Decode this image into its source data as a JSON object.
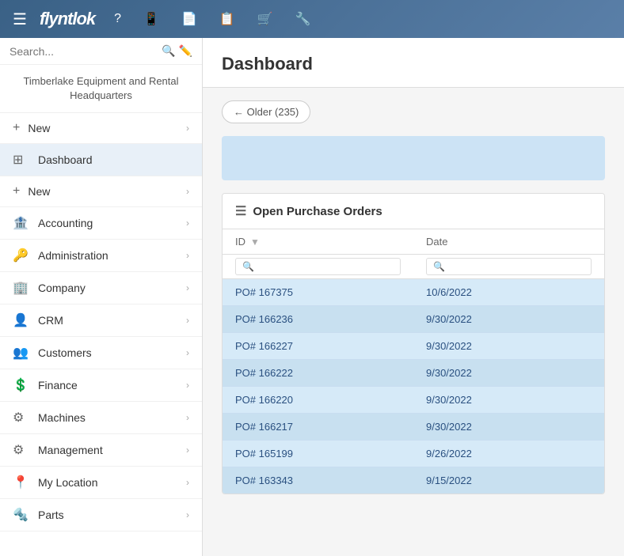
{
  "app": {
    "logo": "flyntlok",
    "title": "Dashboard"
  },
  "topnav": {
    "icons": [
      "☰",
      "?",
      "📱",
      "📄",
      "📋",
      "🛒",
      "🔧"
    ]
  },
  "sidebar": {
    "search_placeholder": "Search...",
    "company_name": "Timberlake Equipment and Rental",
    "company_sub": "Headquarters",
    "items": [
      {
        "id": "new-top",
        "label": "New",
        "icon": "+",
        "has_chevron": true,
        "type": "plus"
      },
      {
        "id": "dashboard",
        "label": "Dashboard",
        "icon": "⊞",
        "has_chevron": false,
        "type": "icon"
      },
      {
        "id": "new-2",
        "label": "New",
        "icon": "+",
        "has_chevron": true,
        "type": "plus"
      },
      {
        "id": "accounting",
        "label": "Accounting",
        "icon": "🏦",
        "has_chevron": true,
        "type": "icon"
      },
      {
        "id": "administration",
        "label": "Administration",
        "icon": "🔑",
        "has_chevron": true,
        "type": "icon"
      },
      {
        "id": "company",
        "label": "Company",
        "icon": "⚙",
        "has_chevron": true,
        "type": "icon"
      },
      {
        "id": "crm",
        "label": "CRM",
        "icon": "👤",
        "has_chevron": true,
        "type": "icon"
      },
      {
        "id": "customers",
        "label": "Customers",
        "icon": "👥",
        "has_chevron": true,
        "type": "icon"
      },
      {
        "id": "finance",
        "label": "Finance",
        "icon": "💲",
        "has_chevron": true,
        "type": "icon"
      },
      {
        "id": "machines",
        "label": "Machines",
        "icon": "⚙",
        "has_chevron": true,
        "type": "icon"
      },
      {
        "id": "management",
        "label": "Management",
        "icon": "⚙",
        "has_chevron": true,
        "type": "icon"
      },
      {
        "id": "my-location",
        "label": "My Location",
        "icon": "⚙",
        "has_chevron": true,
        "type": "icon"
      },
      {
        "id": "parts",
        "label": "Parts",
        "icon": "⚙",
        "has_chevron": true,
        "type": "icon"
      }
    ]
  },
  "content": {
    "title": "Dashboard",
    "older_button": "← Older (235)",
    "table": {
      "title": "Open Purchase Orders",
      "columns": [
        "ID",
        "Date"
      ],
      "rows": [
        {
          "id": "PO# 167375",
          "date": "10/6/2022"
        },
        {
          "id": "PO# 166236",
          "date": "9/30/2022"
        },
        {
          "id": "PO# 166227",
          "date": "9/30/2022"
        },
        {
          "id": "PO# 166222",
          "date": "9/30/2022"
        },
        {
          "id": "PO# 166220",
          "date": "9/30/2022"
        },
        {
          "id": "PO# 166217",
          "date": "9/30/2022"
        },
        {
          "id": "PO# 165199",
          "date": "9/26/2022"
        },
        {
          "id": "PO# 163343",
          "date": "9/15/2022"
        }
      ]
    }
  }
}
